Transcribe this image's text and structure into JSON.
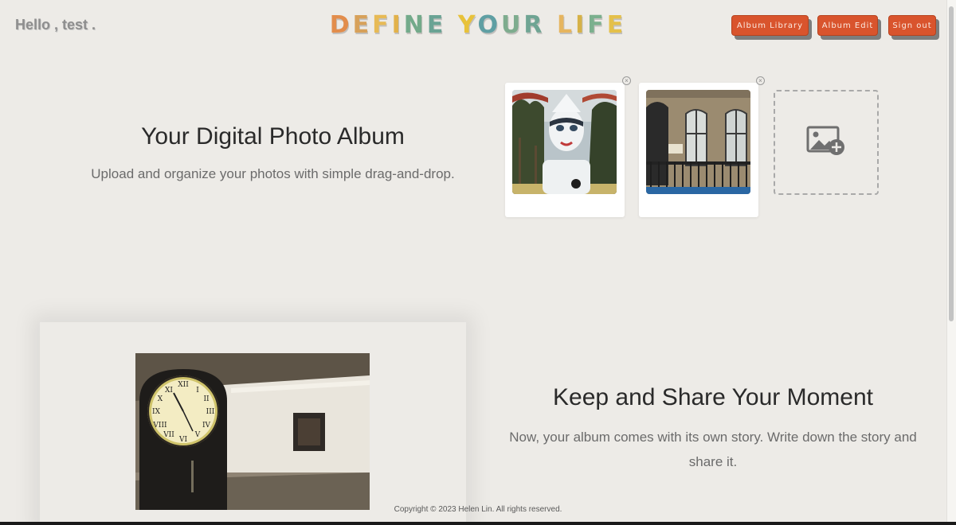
{
  "header": {
    "greeting": "Hello , test .",
    "brand_words": [
      [
        {
          "ch": "D",
          "color": "#e28d4c"
        },
        {
          "ch": "E",
          "color": "#d7a15a"
        },
        {
          "ch": "F",
          "color": "#e7ba55"
        },
        {
          "ch": "I",
          "color": "#e2b24b"
        },
        {
          "ch": "N",
          "color": "#73aa8a"
        },
        {
          "ch": "E",
          "color": "#6aa394"
        }
      ],
      [
        {
          "ch": "Y",
          "color": "#e8c23a"
        },
        {
          "ch": "O",
          "color": "#5f9fa3"
        },
        {
          "ch": "U",
          "color": "#7eac8e"
        },
        {
          "ch": "R",
          "color": "#6fa493"
        }
      ],
      [
        {
          "ch": "L",
          "color": "#e6b55f"
        },
        {
          "ch": "I",
          "color": "#d6b248"
        },
        {
          "ch": "F",
          "color": "#7bb08e"
        },
        {
          "ch": "E",
          "color": "#e4c04a"
        }
      ]
    ],
    "nav": {
      "album_library": "Album Library",
      "album_edit": "Album Edit",
      "sign_out": "Sign out"
    }
  },
  "hero": {
    "title": "Your Digital Photo Album",
    "subtitle": "Upload and organize your photos with simple drag-and-drop.",
    "remove_symbol": "×"
  },
  "feature": {
    "title": "Keep and Share Your Moment",
    "body": "Now, your album comes with its own story. Write down the story and share it."
  },
  "footer": {
    "copyright": "Copyright © 2023 Helen Lin. All rights reserved."
  },
  "colors": {
    "background": "#edebe7",
    "accent": "#d9542d",
    "nav_shadow": "#7d7d7d"
  },
  "icons": {
    "add_photo": "image-plus-icon",
    "remove": "close-circle-icon"
  }
}
